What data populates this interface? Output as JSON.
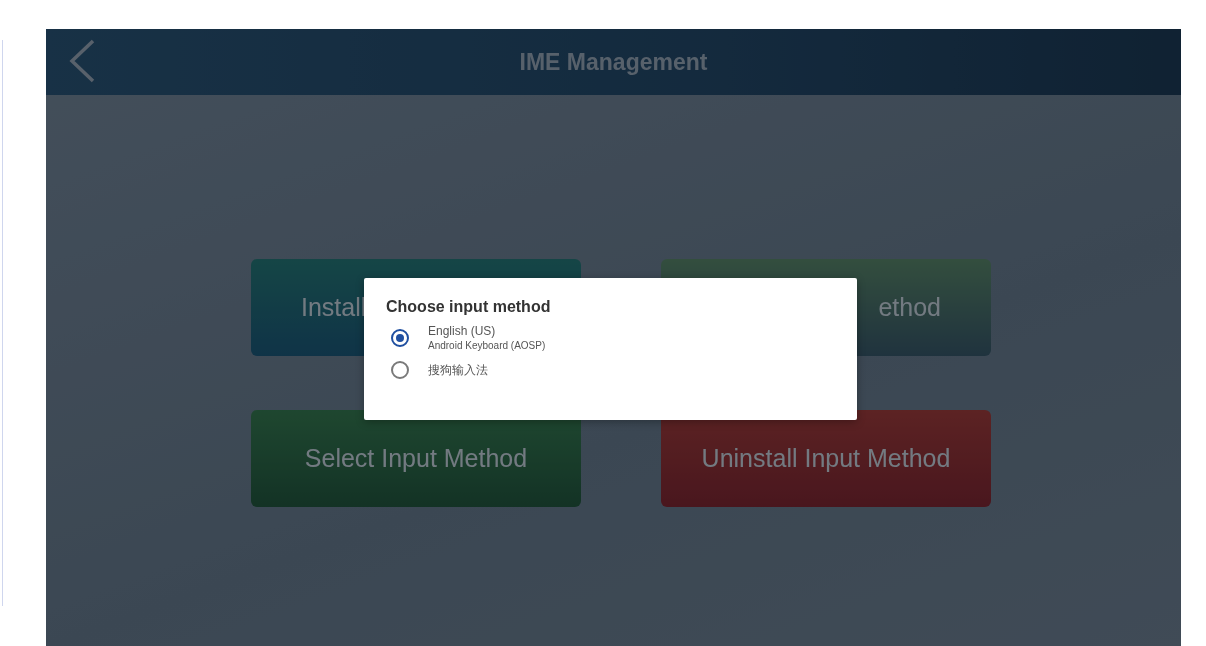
{
  "header": {
    "title": "IME Management"
  },
  "buttons": [
    {
      "label": "Install",
      "kind": "teal"
    },
    {
      "label": "ethod",
      "kind": "olive"
    },
    {
      "label": "Select Input Method",
      "kind": "green"
    },
    {
      "label": "Uninstall Input Method",
      "kind": "red"
    }
  ],
  "dialog": {
    "title": "Choose input method",
    "options": [
      {
        "label": "English (US)",
        "sublabel": "Android Keyboard (AOSP)",
        "selected": true
      },
      {
        "label": "搜狗输入法",
        "selected": false
      }
    ]
  }
}
